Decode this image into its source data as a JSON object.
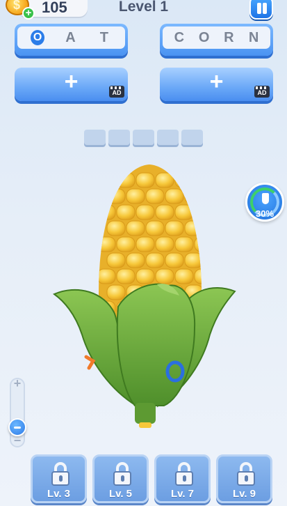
{
  "header": {
    "coins": "105",
    "coin_symbol": "$",
    "coin_add": "+",
    "level_title": "Level 1"
  },
  "words": [
    {
      "letters": [
        "O",
        "A",
        "T"
      ],
      "found": [
        true,
        false,
        false
      ]
    },
    {
      "letters": [
        "C",
        "O",
        "R",
        "N"
      ],
      "found": [
        false,
        false,
        false,
        false
      ]
    }
  ],
  "add_word_buttons": [
    {
      "label": "+",
      "badge": "AD"
    },
    {
      "label": "+",
      "badge": "AD"
    }
  ],
  "letter_slot_count": 5,
  "progress": {
    "percent_text": "30%",
    "value": 0.3
  },
  "zoom": {
    "plus": "+",
    "minus": "−",
    "level": 0.3
  },
  "locked_levels": [
    {
      "label": "Lv. 3"
    },
    {
      "label": "Lv. 5"
    },
    {
      "label": "Lv. 7"
    },
    {
      "label": "Lv. 9"
    }
  ],
  "object_letters": [
    "O"
  ],
  "colors": {
    "accent": "#2b7de9",
    "kernel": "#f7c83a",
    "husk": "#6fb03c",
    "progress_green": "#3ed06a"
  }
}
